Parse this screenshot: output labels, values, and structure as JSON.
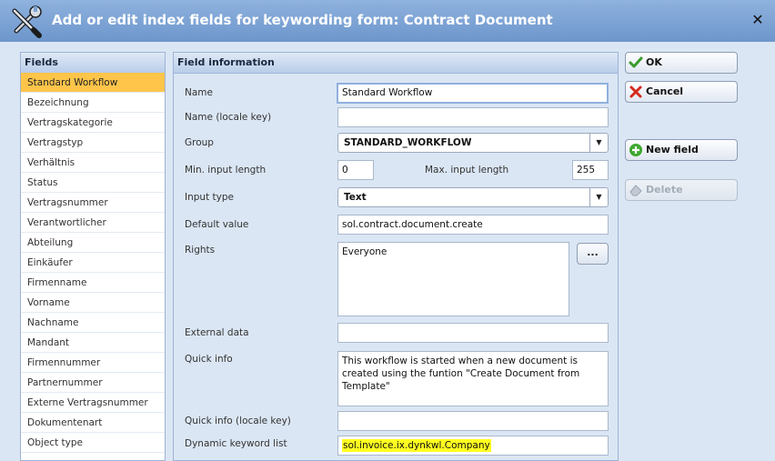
{
  "window": {
    "title": "Add or edit index fields for keywording form: Contract Document",
    "close_label": "✕"
  },
  "fields": {
    "header": "Fields",
    "items": [
      "Standard Workflow",
      "Bezeichnung",
      "Vertragskategorie",
      "Vertragstyp",
      "Verhältnis",
      "Status",
      "Vertragsnummer",
      "Verantwortlicher",
      "Abteilung",
      "Einkäufer",
      "Firmenname",
      "Vorname",
      "Nachname",
      "Mandant",
      "Firmennummer",
      "Partnernummer",
      "Externe Vertragsnummer",
      "Dokumentenart",
      "Object type"
    ],
    "selected": "Standard Workflow"
  },
  "info": {
    "header": "Field information",
    "name_label": "Name",
    "name_value": "Standard Workflow",
    "name_locale_label": "Name (locale key)",
    "name_locale_value": "",
    "group_label": "Group",
    "group_value": "STANDARD_WORKFLOW",
    "min_label": "Min. input length",
    "min_value": "0",
    "max_label": "Max. input length",
    "max_value": "255",
    "input_type_label": "Input type",
    "input_type_value": "Text",
    "default_label": "Default value",
    "default_value": "sol.contract.document.create",
    "rights_label": "Rights",
    "rights_value": "Everyone",
    "rights_button": "...",
    "external_label": "External data",
    "external_value": "",
    "quickinfo_label": "Quick info",
    "quickinfo_value": "This workflow is started when a new document is created using the funtion \"Create Document from Template\"",
    "quickinfo_locale_label": "Quick info (locale key)",
    "quickinfo_locale_value": "",
    "dynamic_label": "Dynamic keyword list",
    "dynamic_value": "sol.invoice.ix.dynkwl.Company",
    "highlight_color": "#ffff22"
  },
  "buttons": {
    "ok": "OK",
    "cancel": "Cancel",
    "new_field": "New field",
    "delete": "Delete"
  },
  "colors": {
    "titlebar": "#7aa1d4",
    "selected_row": "#ffc54a"
  }
}
